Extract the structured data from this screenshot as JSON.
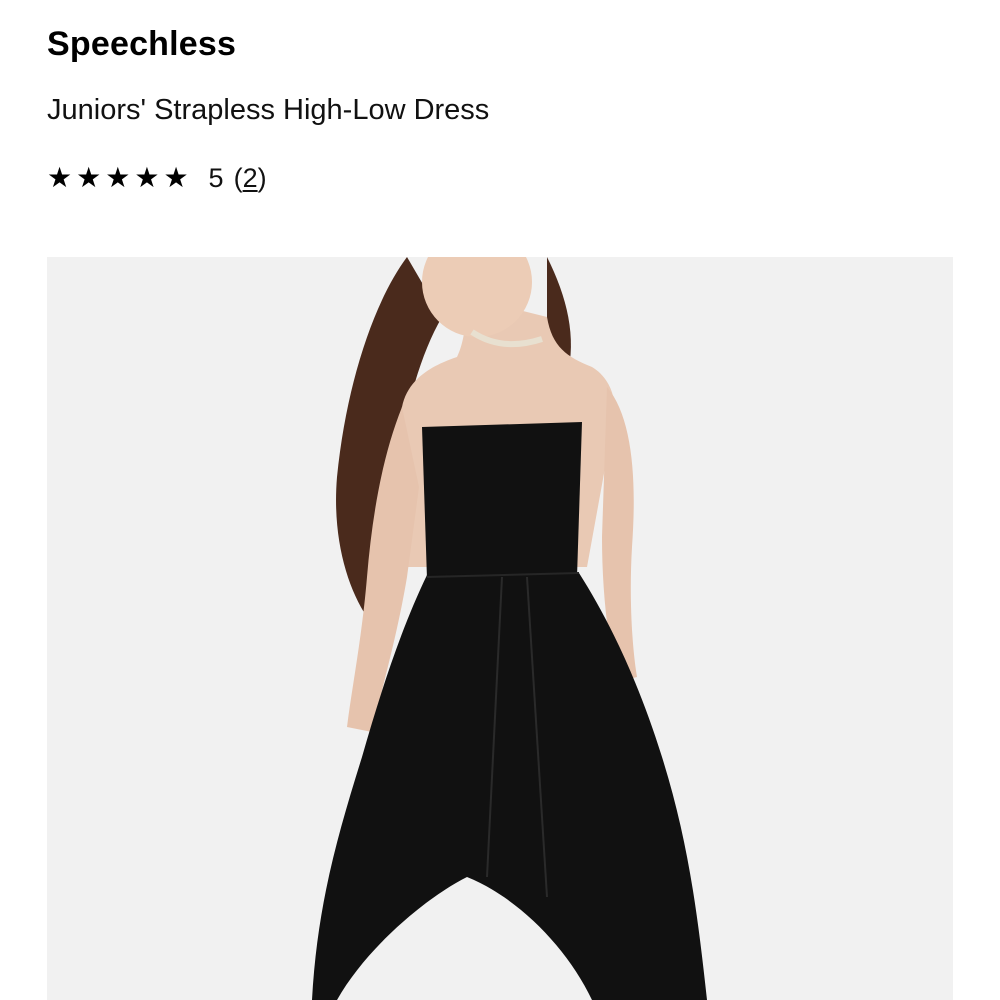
{
  "product": {
    "brand": "Speechless",
    "title": "Juniors' Strapless High-Low Dress",
    "rating": {
      "stars": 5,
      "value_label": "5",
      "count_open": "(",
      "count": "2",
      "count_close": ")"
    },
    "image": {
      "alt": "Juniors' Strapless High-Low Dress",
      "background_color": "#f1f1f1",
      "dress_color": "#111111"
    }
  }
}
